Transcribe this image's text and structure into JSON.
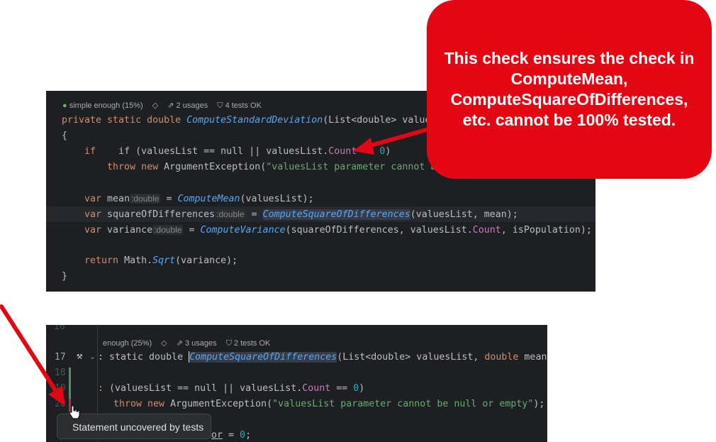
{
  "callout": {
    "text": "This check ensures the check in ComputeMean, ComputeSquareOfDifferences, etc. cannot be 100% tested."
  },
  "panel1": {
    "hints": {
      "complexity": "simple enough (15%)",
      "usages": "2 usages",
      "tests": "4 tests OK"
    },
    "lines": {
      "l1": {
        "kw": "private static double ",
        "fn": "ComputeStandardDeviation",
        "rest": "(List<double> valuesL"
      },
      "l2": "{",
      "l3": {
        "a": "    if (valuesList == null || valuesList.",
        "prop": "Count",
        "b": " == ",
        "num": "0",
        "c": ")"
      },
      "l4": {
        "kw": "        throw new ",
        "a": "ArgumentException(",
        "str": "\"valuesList parameter cannot be n"
      },
      "l5": {
        "kw": "    var ",
        "a": "mean",
        "inlay": ":double",
        "b": " = ",
        "fn": "ComputeMean",
        "c": "(valuesList);"
      },
      "l6": {
        "kw": "    var ",
        "a": "squareOfDifferences",
        "inlay": ":double",
        "b": " = ",
        "fn": "ComputeSquareOfDifferences",
        "c": "(valuesList, mean);"
      },
      "l7": {
        "kw": "    var ",
        "a": "variance",
        "inlay": ":double",
        "b": " = ",
        "fn": "ComputeVariance",
        "c": "(squareOfDifferences, valuesList.",
        "prop": "Count",
        "d": ", isPopulation);"
      },
      "l8": {
        "kw": "    return ",
        "a": "Math.",
        "fn": "Sqrt",
        "c": "(variance);"
      },
      "l9": "}"
    }
  },
  "panel2": {
    "line_numbers": [
      "16",
      "17",
      "18",
      "19",
      "20"
    ],
    "hints": {
      "complexity": "enough (25%)",
      "usages": "3 usages",
      "tests": "2 tests OK"
    },
    "lines": {
      "l17": {
        "a": ": static double ",
        "fn": "ComputeSquareOfDifferences",
        "b": "(List<double> valuesList, ",
        "kw": "double",
        "c": " mean)"
      },
      "l19": {
        "a": " (valuesList == null || valuesList.",
        "prop": "Count",
        "b": " == ",
        "num": "0",
        "c": ")"
      },
      "l20": {
        "kw": "throw new ",
        "a": "ArgumentException(",
        "str": "\"valuesList parameter cannot be null or empty\"",
        "c": ");"
      },
      "l22": {
        "a": "or",
        "b": " = ",
        "num": "0",
        "c": ";"
      }
    }
  },
  "tooltip": {
    "text": "Statement uncovered by tests"
  },
  "colors": {
    "callout": "#e30613",
    "arrow": "#e30613",
    "editor_bg": "#1e1f22"
  },
  "icons": [
    "complexity-dot-icon",
    "diamond-icon",
    "usages-icon",
    "shield-icon",
    "hammer-icon",
    "chevron-down-icon",
    "hand-cursor-icon"
  ]
}
